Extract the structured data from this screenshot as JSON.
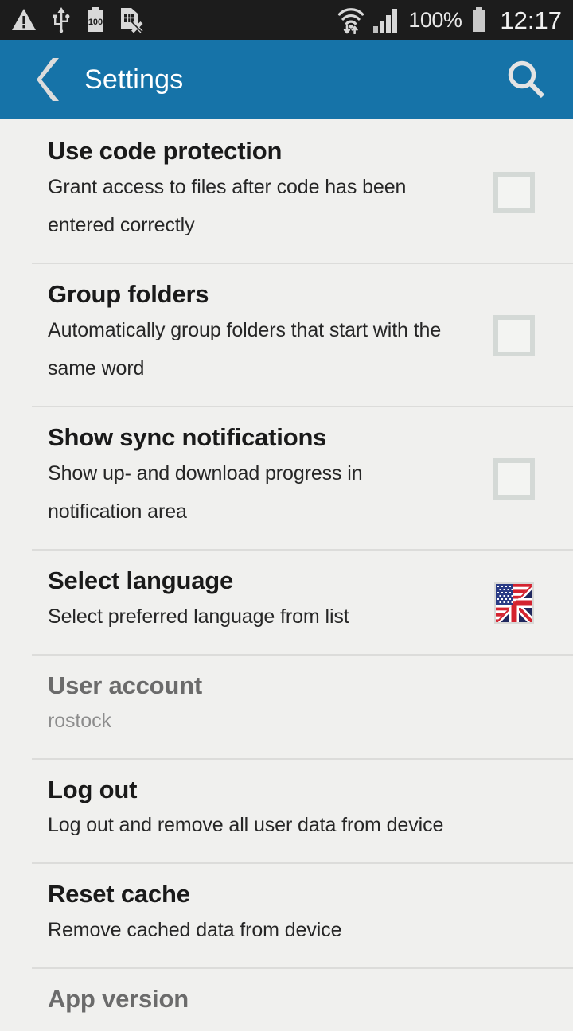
{
  "status_bar": {
    "icons_left": [
      "warning-triangle-icon",
      "usb-icon",
      "battery-100-icon",
      "sim-card-error-icon"
    ],
    "icons_right": [
      "wifi-transfer-icon",
      "cellular-signal-icon"
    ],
    "battery_percent": "100%",
    "battery_icon": "battery-full-icon",
    "clock": "12:17"
  },
  "action_bar": {
    "back_icon": "back-chevron-icon",
    "title": "Settings",
    "search_icon": "search-icon"
  },
  "settings": {
    "items": [
      {
        "title": "Use code protection",
        "subtitle": "Grant access to files after code has been entered correctly",
        "accessory": "checkbox",
        "checked": false,
        "enabled": true
      },
      {
        "title": "Group folders",
        "subtitle": "Automatically group folders that start with the same word",
        "accessory": "checkbox",
        "checked": false,
        "enabled": true
      },
      {
        "title": "Show sync notifications",
        "subtitle": "Show up- and download progress in notification area",
        "accessory": "checkbox",
        "checked": false,
        "enabled": true
      },
      {
        "title": "Select language",
        "subtitle": "Select preferred language from list",
        "accessory": "flag",
        "flag_icon": "us-uk-flag-icon",
        "enabled": true
      },
      {
        "title": "User account",
        "subtitle": "rostock",
        "accessory": "none",
        "enabled": false
      },
      {
        "title": "Log out",
        "subtitle": "Log out and remove all user data from device",
        "accessory": "none",
        "enabled": true
      },
      {
        "title": "Reset cache",
        "subtitle": "Remove cached data from device",
        "accessory": "none",
        "enabled": true
      },
      {
        "title": "App version",
        "subtitle": "",
        "accessory": "none",
        "enabled": false
      }
    ]
  },
  "colors": {
    "action_bar": "#1673a8",
    "status_bar": "#1c1c1c",
    "page_background": "#f0f0ee",
    "divider": "#dcdcda",
    "checkbox_border": "#d4d9d6",
    "title_text": "#1a1a1a",
    "disabled_text": "#6b6b6b"
  }
}
